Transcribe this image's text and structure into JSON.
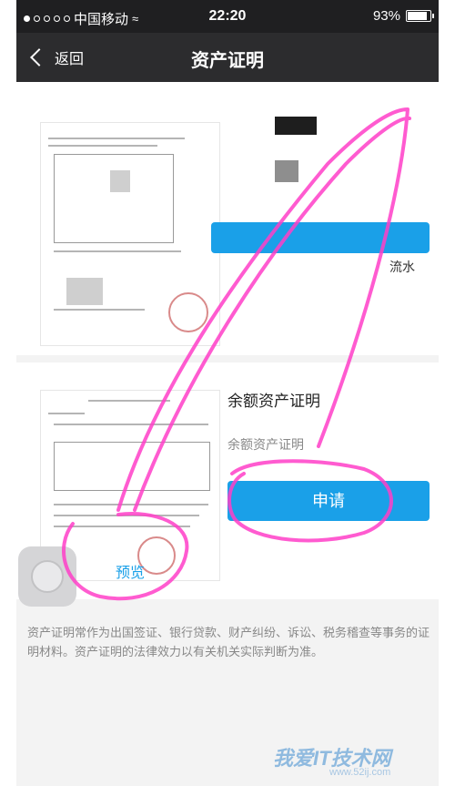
{
  "status_bar": {
    "carrier": "中国移动",
    "time": "22:20",
    "battery": "93%",
    "battery_level": 0.93
  },
  "nav": {
    "back_label": "返回",
    "title": "资产证明"
  },
  "card_top": {
    "partial_text": "流水"
  },
  "card_balance": {
    "title": "余额资产证明",
    "subtitle": "余额资产证明",
    "apply_label": "申请",
    "preview_label": "预览"
  },
  "footnote": "资产证明常作为出国签证、银行贷款、财产纠纷、诉讼、税务稽查等事务的证明材料。资产证明的法律效力以有关机关实际判断为准。",
  "watermark": {
    "main": "我爱IT技术网",
    "url": "www.52ij.com"
  },
  "colors": {
    "accent": "#1aa0e8",
    "nav_bg": "#2c2c2e",
    "annotation": "#ff3fc8"
  }
}
